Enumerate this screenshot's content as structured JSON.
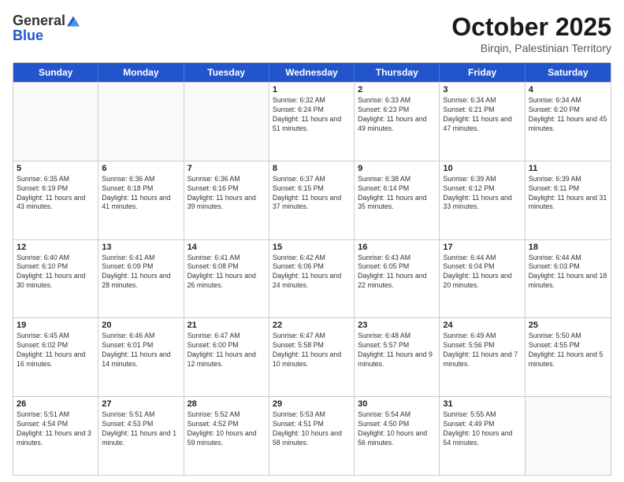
{
  "logo": {
    "general": "General",
    "blue": "Blue"
  },
  "title": {
    "month": "October 2025",
    "location": "Birqin, Palestinian Territory"
  },
  "weekdays": [
    "Sunday",
    "Monday",
    "Tuesday",
    "Wednesday",
    "Thursday",
    "Friday",
    "Saturday"
  ],
  "rows": [
    [
      {
        "day": "",
        "info": ""
      },
      {
        "day": "",
        "info": ""
      },
      {
        "day": "",
        "info": ""
      },
      {
        "day": "1",
        "info": "Sunrise: 6:32 AM\nSunset: 6:24 PM\nDaylight: 11 hours and 51 minutes."
      },
      {
        "day": "2",
        "info": "Sunrise: 6:33 AM\nSunset: 6:23 PM\nDaylight: 11 hours and 49 minutes."
      },
      {
        "day": "3",
        "info": "Sunrise: 6:34 AM\nSunset: 6:21 PM\nDaylight: 11 hours and 47 minutes."
      },
      {
        "day": "4",
        "info": "Sunrise: 6:34 AM\nSunset: 6:20 PM\nDaylight: 11 hours and 45 minutes."
      }
    ],
    [
      {
        "day": "5",
        "info": "Sunrise: 6:35 AM\nSunset: 6:19 PM\nDaylight: 11 hours and 43 minutes."
      },
      {
        "day": "6",
        "info": "Sunrise: 6:36 AM\nSunset: 6:18 PM\nDaylight: 11 hours and 41 minutes."
      },
      {
        "day": "7",
        "info": "Sunrise: 6:36 AM\nSunset: 6:16 PM\nDaylight: 11 hours and 39 minutes."
      },
      {
        "day": "8",
        "info": "Sunrise: 6:37 AM\nSunset: 6:15 PM\nDaylight: 11 hours and 37 minutes."
      },
      {
        "day": "9",
        "info": "Sunrise: 6:38 AM\nSunset: 6:14 PM\nDaylight: 11 hours and 35 minutes."
      },
      {
        "day": "10",
        "info": "Sunrise: 6:39 AM\nSunset: 6:12 PM\nDaylight: 11 hours and 33 minutes."
      },
      {
        "day": "11",
        "info": "Sunrise: 6:39 AM\nSunset: 6:11 PM\nDaylight: 11 hours and 31 minutes."
      }
    ],
    [
      {
        "day": "12",
        "info": "Sunrise: 6:40 AM\nSunset: 6:10 PM\nDaylight: 11 hours and 30 minutes."
      },
      {
        "day": "13",
        "info": "Sunrise: 6:41 AM\nSunset: 6:09 PM\nDaylight: 11 hours and 28 minutes."
      },
      {
        "day": "14",
        "info": "Sunrise: 6:41 AM\nSunset: 6:08 PM\nDaylight: 11 hours and 26 minutes."
      },
      {
        "day": "15",
        "info": "Sunrise: 6:42 AM\nSunset: 6:06 PM\nDaylight: 11 hours and 24 minutes."
      },
      {
        "day": "16",
        "info": "Sunrise: 6:43 AM\nSunset: 6:05 PM\nDaylight: 11 hours and 22 minutes."
      },
      {
        "day": "17",
        "info": "Sunrise: 6:44 AM\nSunset: 6:04 PM\nDaylight: 11 hours and 20 minutes."
      },
      {
        "day": "18",
        "info": "Sunrise: 6:44 AM\nSunset: 6:03 PM\nDaylight: 11 hours and 18 minutes."
      }
    ],
    [
      {
        "day": "19",
        "info": "Sunrise: 6:45 AM\nSunset: 6:02 PM\nDaylight: 11 hours and 16 minutes."
      },
      {
        "day": "20",
        "info": "Sunrise: 6:46 AM\nSunset: 6:01 PM\nDaylight: 11 hours and 14 minutes."
      },
      {
        "day": "21",
        "info": "Sunrise: 6:47 AM\nSunset: 6:00 PM\nDaylight: 11 hours and 12 minutes."
      },
      {
        "day": "22",
        "info": "Sunrise: 6:47 AM\nSunset: 5:58 PM\nDaylight: 11 hours and 10 minutes."
      },
      {
        "day": "23",
        "info": "Sunrise: 6:48 AM\nSunset: 5:57 PM\nDaylight: 11 hours and 9 minutes."
      },
      {
        "day": "24",
        "info": "Sunrise: 6:49 AM\nSunset: 5:56 PM\nDaylight: 11 hours and 7 minutes."
      },
      {
        "day": "25",
        "info": "Sunrise: 5:50 AM\nSunset: 4:55 PM\nDaylight: 11 hours and 5 minutes."
      }
    ],
    [
      {
        "day": "26",
        "info": "Sunrise: 5:51 AM\nSunset: 4:54 PM\nDaylight: 11 hours and 3 minutes."
      },
      {
        "day": "27",
        "info": "Sunrise: 5:51 AM\nSunset: 4:53 PM\nDaylight: 11 hours and 1 minute."
      },
      {
        "day": "28",
        "info": "Sunrise: 5:52 AM\nSunset: 4:52 PM\nDaylight: 10 hours and 59 minutes."
      },
      {
        "day": "29",
        "info": "Sunrise: 5:53 AM\nSunset: 4:51 PM\nDaylight: 10 hours and 58 minutes."
      },
      {
        "day": "30",
        "info": "Sunrise: 5:54 AM\nSunset: 4:50 PM\nDaylight: 10 hours and 56 minutes."
      },
      {
        "day": "31",
        "info": "Sunrise: 5:55 AM\nSunset: 4:49 PM\nDaylight: 10 hours and 54 minutes."
      },
      {
        "day": "",
        "info": ""
      }
    ]
  ]
}
